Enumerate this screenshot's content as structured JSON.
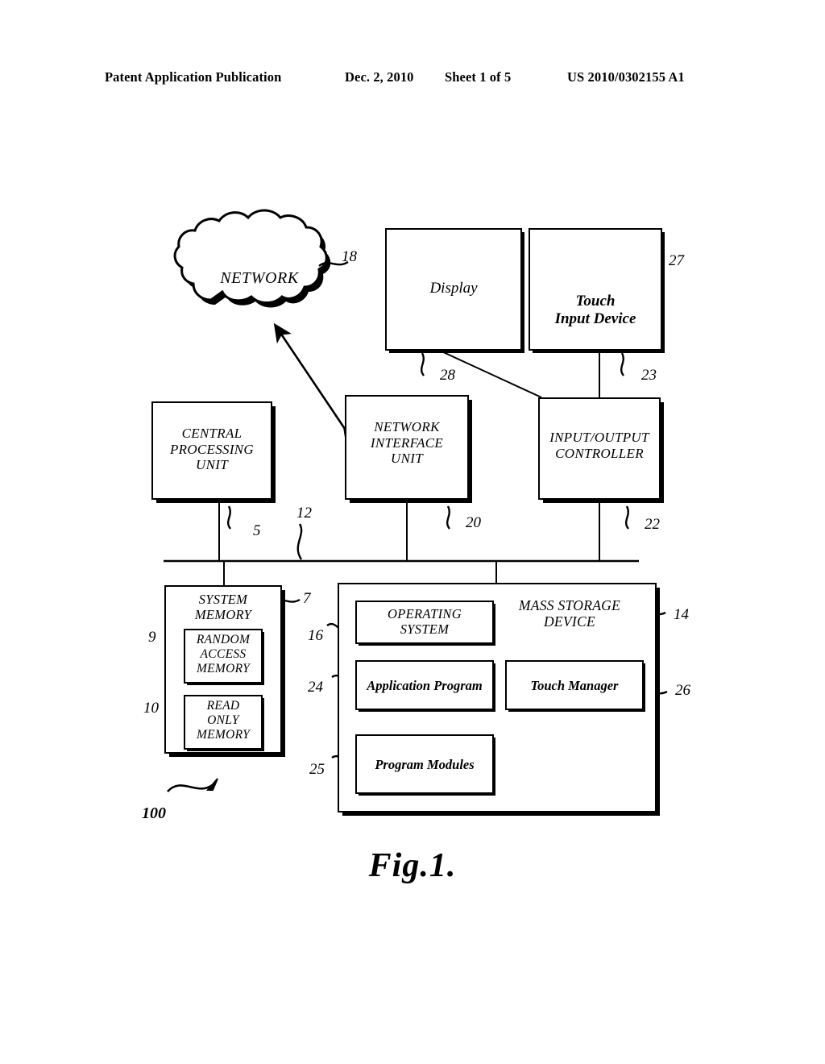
{
  "header": {
    "publication": "Patent Application Publication",
    "date": "Dec. 2, 2010",
    "sheet": "Sheet 1 of 5",
    "number": "US 2010/0302155 A1"
  },
  "figure": {
    "caption": "Fig.1.",
    "system_ref": "100"
  },
  "blocks": {
    "network": {
      "label": "NETWORK",
      "ref": "18"
    },
    "display": {
      "label": "Display",
      "ref": "28",
      "cursor_icon": "mouse-pointer-icon"
    },
    "touch_input": {
      "label": "Touch\nInput Device",
      "ref": "23",
      "icon": "hand-touch-icon",
      "icon_ref": "27"
    },
    "cpu": {
      "label": "CENTRAL\nPROCESSING\nUNIT",
      "ref": "5"
    },
    "network_interface": {
      "label": "NETWORK\nINTERFACE\nUNIT",
      "ref": "20"
    },
    "io_controller": {
      "label": "INPUT/OUTPUT\nCONTROLLER",
      "ref": "22"
    },
    "bus": {
      "ref": "12"
    },
    "system_memory": {
      "label": "SYSTEM\nMEMORY",
      "ref": "7"
    },
    "ram": {
      "label": "RANDOM\nACCESS\nMEMORY",
      "ref": "9"
    },
    "rom": {
      "label": "READ\nONLY\nMEMORY",
      "ref": "10"
    },
    "mass_storage": {
      "label": "MASS STORAGE\nDEVICE",
      "ref": "14"
    },
    "operating_system": {
      "label": "OPERATING\nSYSTEM",
      "ref": "16"
    },
    "application_program": {
      "label": "Application Program",
      "ref": "24"
    },
    "touch_manager": {
      "label": "Touch Manager",
      "ref": "26"
    },
    "program_modules": {
      "label": "Program Modules",
      "ref": "25"
    }
  },
  "colors": {
    "ink": "#000000",
    "paper": "#ffffff"
  }
}
